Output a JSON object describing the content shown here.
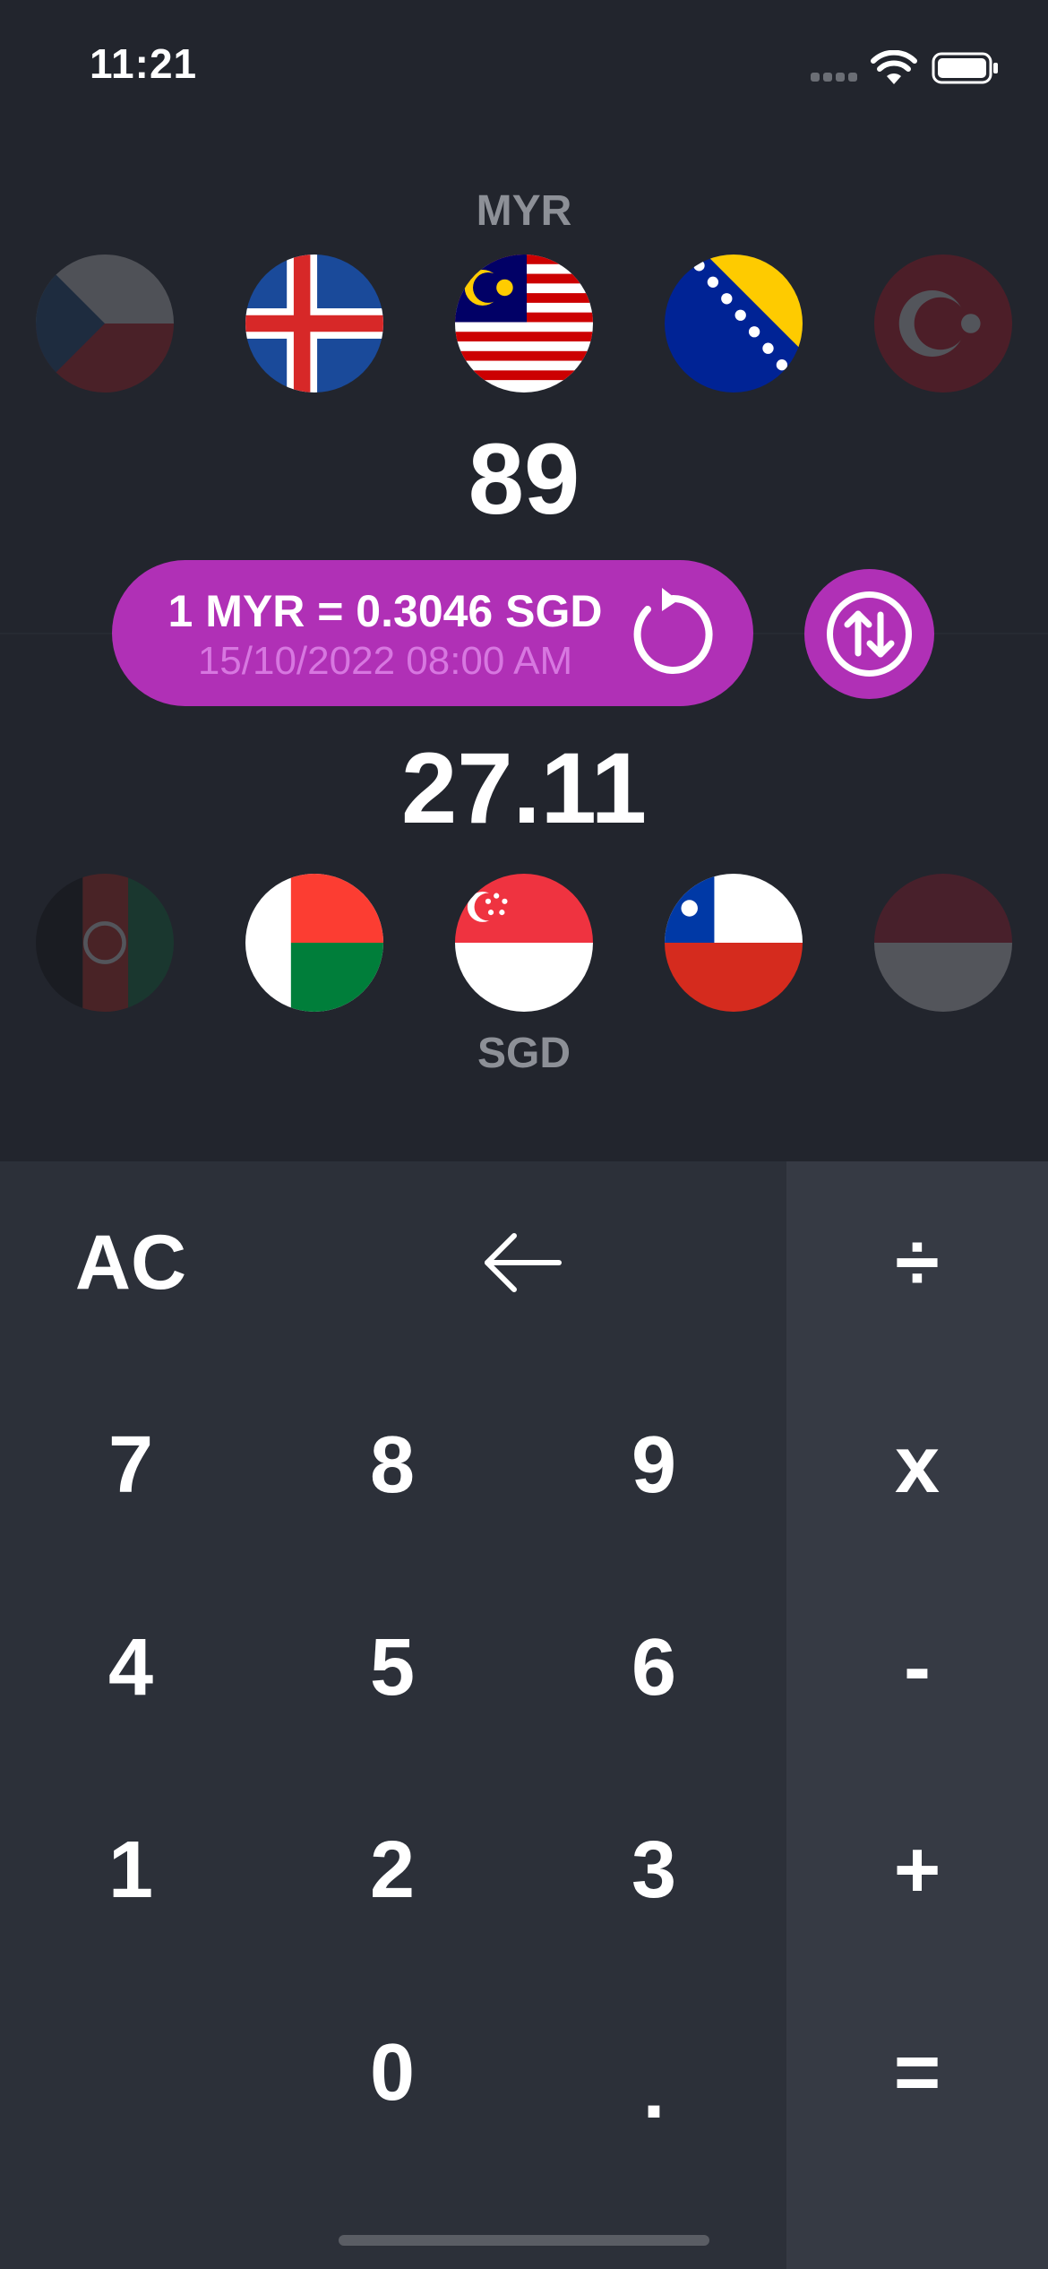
{
  "status_bar": {
    "time": "11:21"
  },
  "from": {
    "code": "MYR",
    "amount": "89"
  },
  "to": {
    "code": "SGD",
    "amount": "27.11"
  },
  "rate": {
    "text": "1 MYR = 0.3046 SGD",
    "updated": "15/10/2022 08:00 AM"
  },
  "colors": {
    "background": "#22252d",
    "accent": "#b030b6",
    "keypad": "#2c3039",
    "operator_column": "#363a44",
    "muted_text": "#8d9097"
  },
  "top_flags": [
    "czech-flag",
    "iceland-flag",
    "malaysia-flag",
    "bosnia-flag",
    "turkey-flag"
  ],
  "bottom_flags": [
    "afghanistan-flag",
    "madagascar-flag",
    "singapore-flag",
    "chile-flag",
    "unknown-flag"
  ],
  "keypad": {
    "ac": "AC",
    "backspace_icon": "arrow-left-icon",
    "divide": "÷",
    "multiply": "x",
    "subtract": "-",
    "add": "+",
    "equals": "=",
    "digits": {
      "d0": "0",
      "d1": "1",
      "d2": "2",
      "d3": "3",
      "d4": "4",
      "d5": "5",
      "d6": "6",
      "d7": "7",
      "d8": "8",
      "d9": "9"
    },
    "decimal": "."
  }
}
